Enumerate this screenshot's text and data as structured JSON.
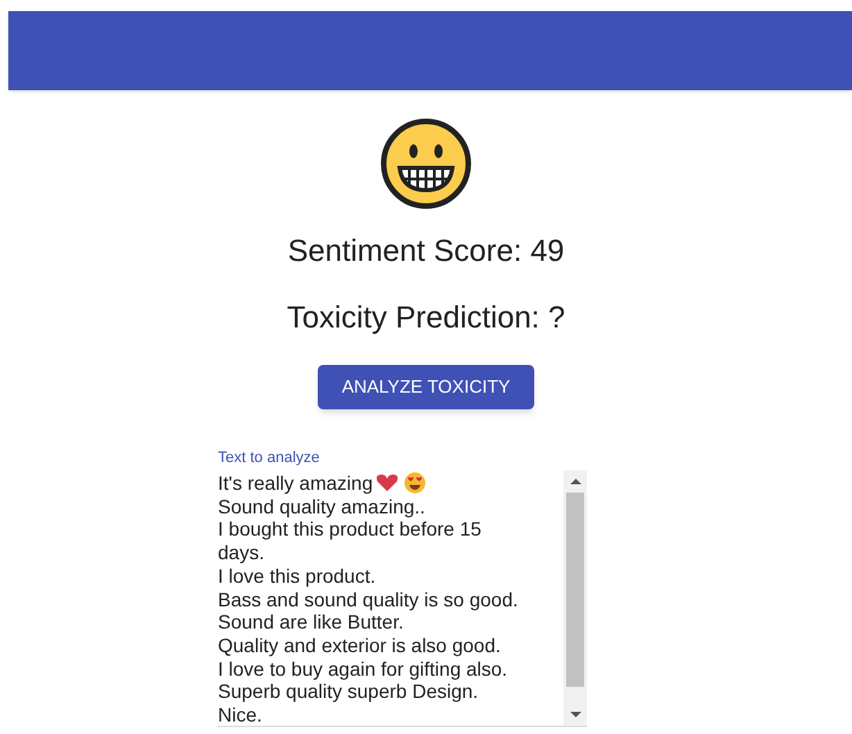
{
  "header": {
    "kind": "app-bar"
  },
  "sentiment_score": "Sentiment Score: 49",
  "toxicity_prediction": "Toxicity Prediction: ?",
  "analyze_button": "ANALYZE TOXICITY",
  "text_field": {
    "label": "Text to analyze",
    "value_lines": [
      "It's really amazing",
      "Sound quality amazing..",
      "I bought this product before 15",
      "days.",
      "I love this product.",
      "Bass and sound quality is so good.",
      "Sound are like Butter.",
      "Quality and exterior is also good.",
      "I love to buy again for gifting also.",
      "Superb quality superb Design.",
      "Nice."
    ]
  }
}
